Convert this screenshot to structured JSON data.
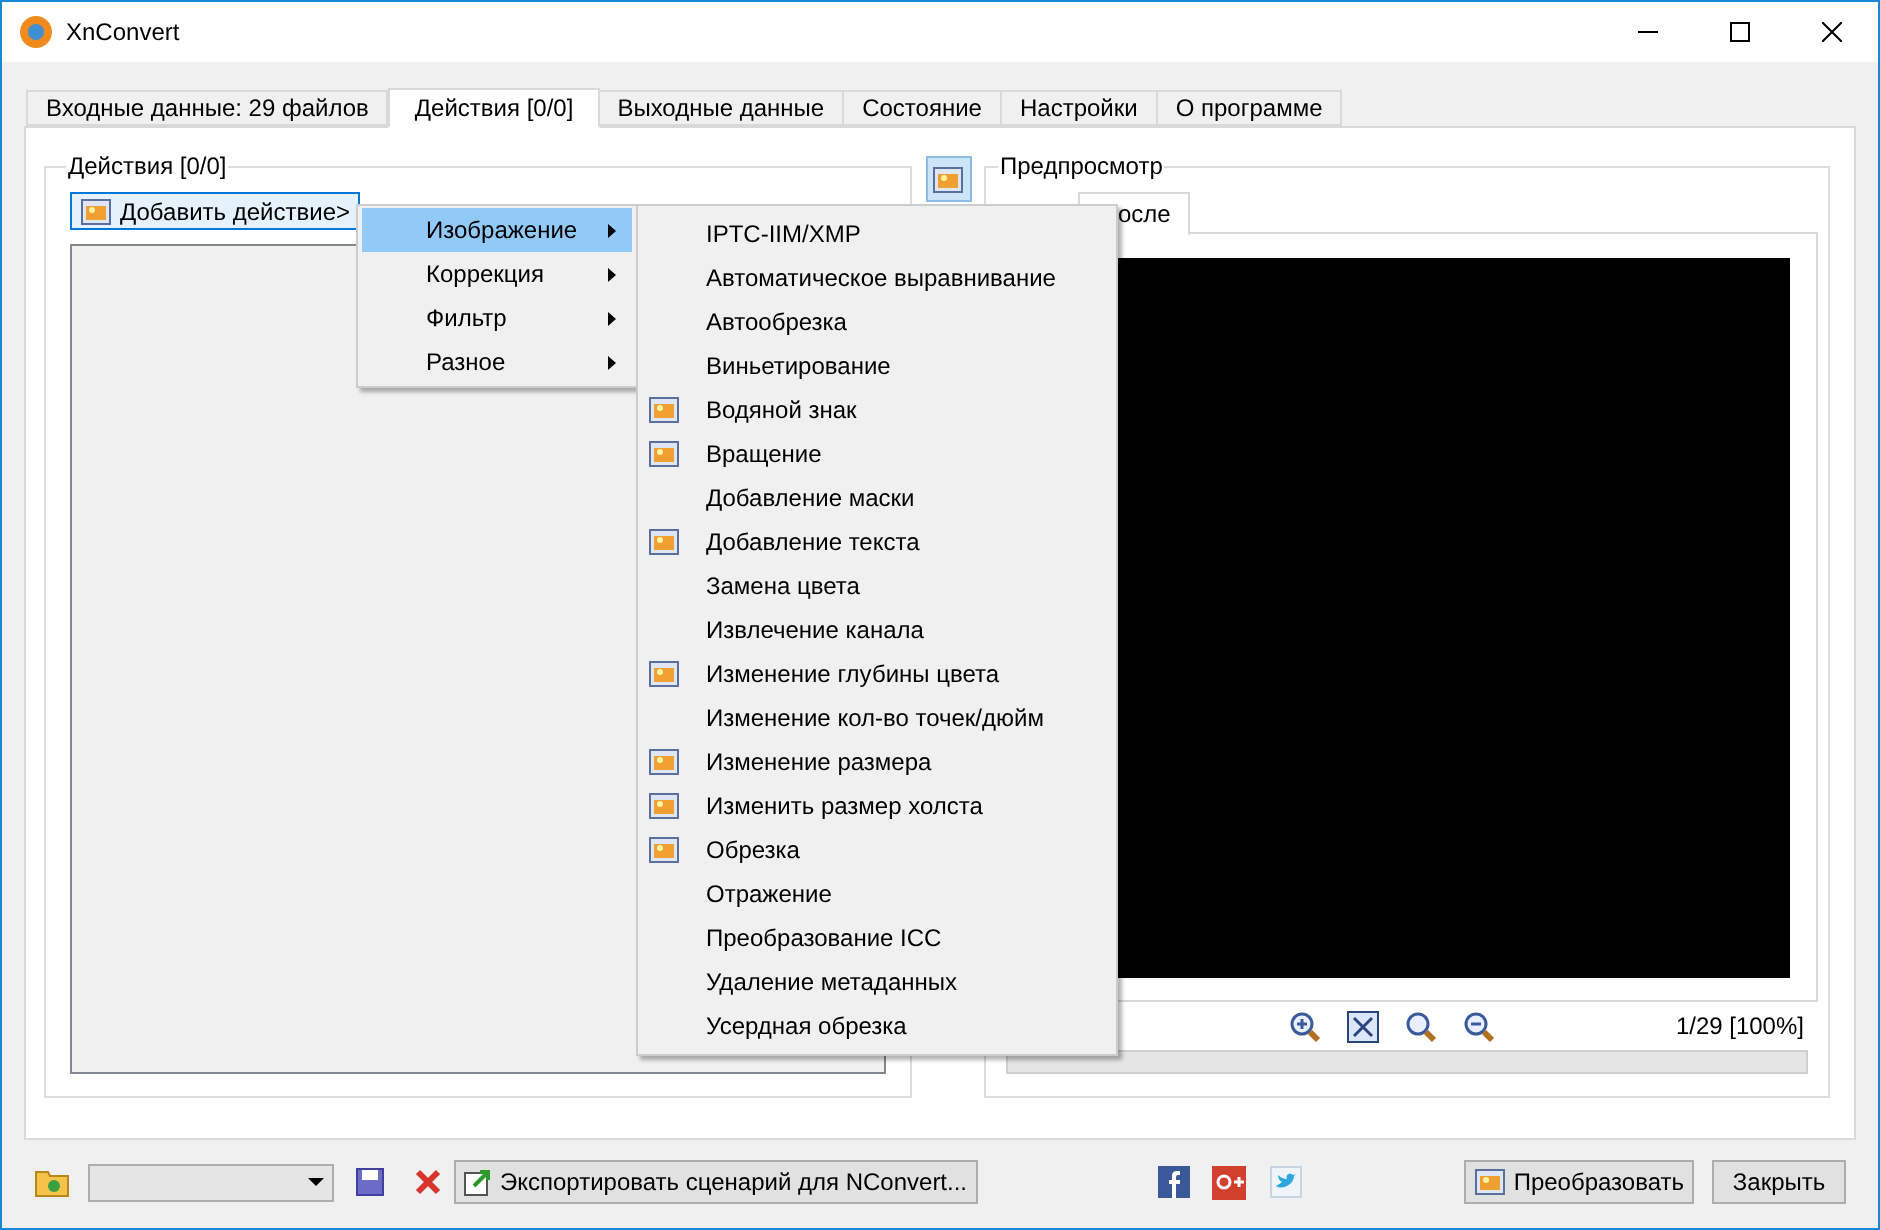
{
  "window": {
    "title": "XnConvert"
  },
  "tabs": [
    {
      "label": "Входные данные: 29 файлов",
      "selected": false
    },
    {
      "label": "Действия [0/0]",
      "selected": true
    },
    {
      "label": "Выходные данные",
      "selected": false
    },
    {
      "label": "Состояние",
      "selected": false
    },
    {
      "label": "Настройки",
      "selected": false
    },
    {
      "label": "О программе",
      "selected": false
    }
  ],
  "actions_group": {
    "title": "Действия [0/0]",
    "add_button": "Добавить действие>"
  },
  "preview_group": {
    "title": "Предпросмотр",
    "tabs": [
      {
        "label": "осле",
        "selected": true
      }
    ],
    "status": "1/29 [100%]"
  },
  "menu": [
    {
      "label": "Изображение",
      "selected": true
    },
    {
      "label": "Коррекция",
      "selected": false
    },
    {
      "label": "Фильтр",
      "selected": false
    },
    {
      "label": "Разное",
      "selected": false
    }
  ],
  "submenu": [
    {
      "label": "IPTC-IIM/XMP",
      "has_icon": false
    },
    {
      "label": "Автоматическое выравнивание",
      "has_icon": false
    },
    {
      "label": "Автообрезка",
      "has_icon": false
    },
    {
      "label": "Виньетирование",
      "has_icon": false
    },
    {
      "label": "Водяной знак",
      "has_icon": true
    },
    {
      "label": "Вращение",
      "has_icon": true
    },
    {
      "label": "Добавление маски",
      "has_icon": false
    },
    {
      "label": "Добавление текста",
      "has_icon": true
    },
    {
      "label": "Замена цвета",
      "has_icon": false
    },
    {
      "label": "Извлечение канала",
      "has_icon": false
    },
    {
      "label": "Изменение глубины цвета",
      "has_icon": true
    },
    {
      "label": "Изменение кол-во точек/дюйм",
      "has_icon": false
    },
    {
      "label": "Изменение размера",
      "has_icon": true
    },
    {
      "label": "Изменить размер холста",
      "has_icon": true
    },
    {
      "label": "Обрезка",
      "has_icon": true
    },
    {
      "label": "Отражение",
      "has_icon": false
    },
    {
      "label": "Преобразование ICC",
      "has_icon": false
    },
    {
      "label": "Удаление метаданных",
      "has_icon": false
    },
    {
      "label": "Усердная обрезка",
      "has_icon": false
    }
  ],
  "bottom": {
    "export_button": "Экспортировать сценарий для NConvert...",
    "convert_button": "Преобразовать",
    "close_button": "Закрыть"
  }
}
